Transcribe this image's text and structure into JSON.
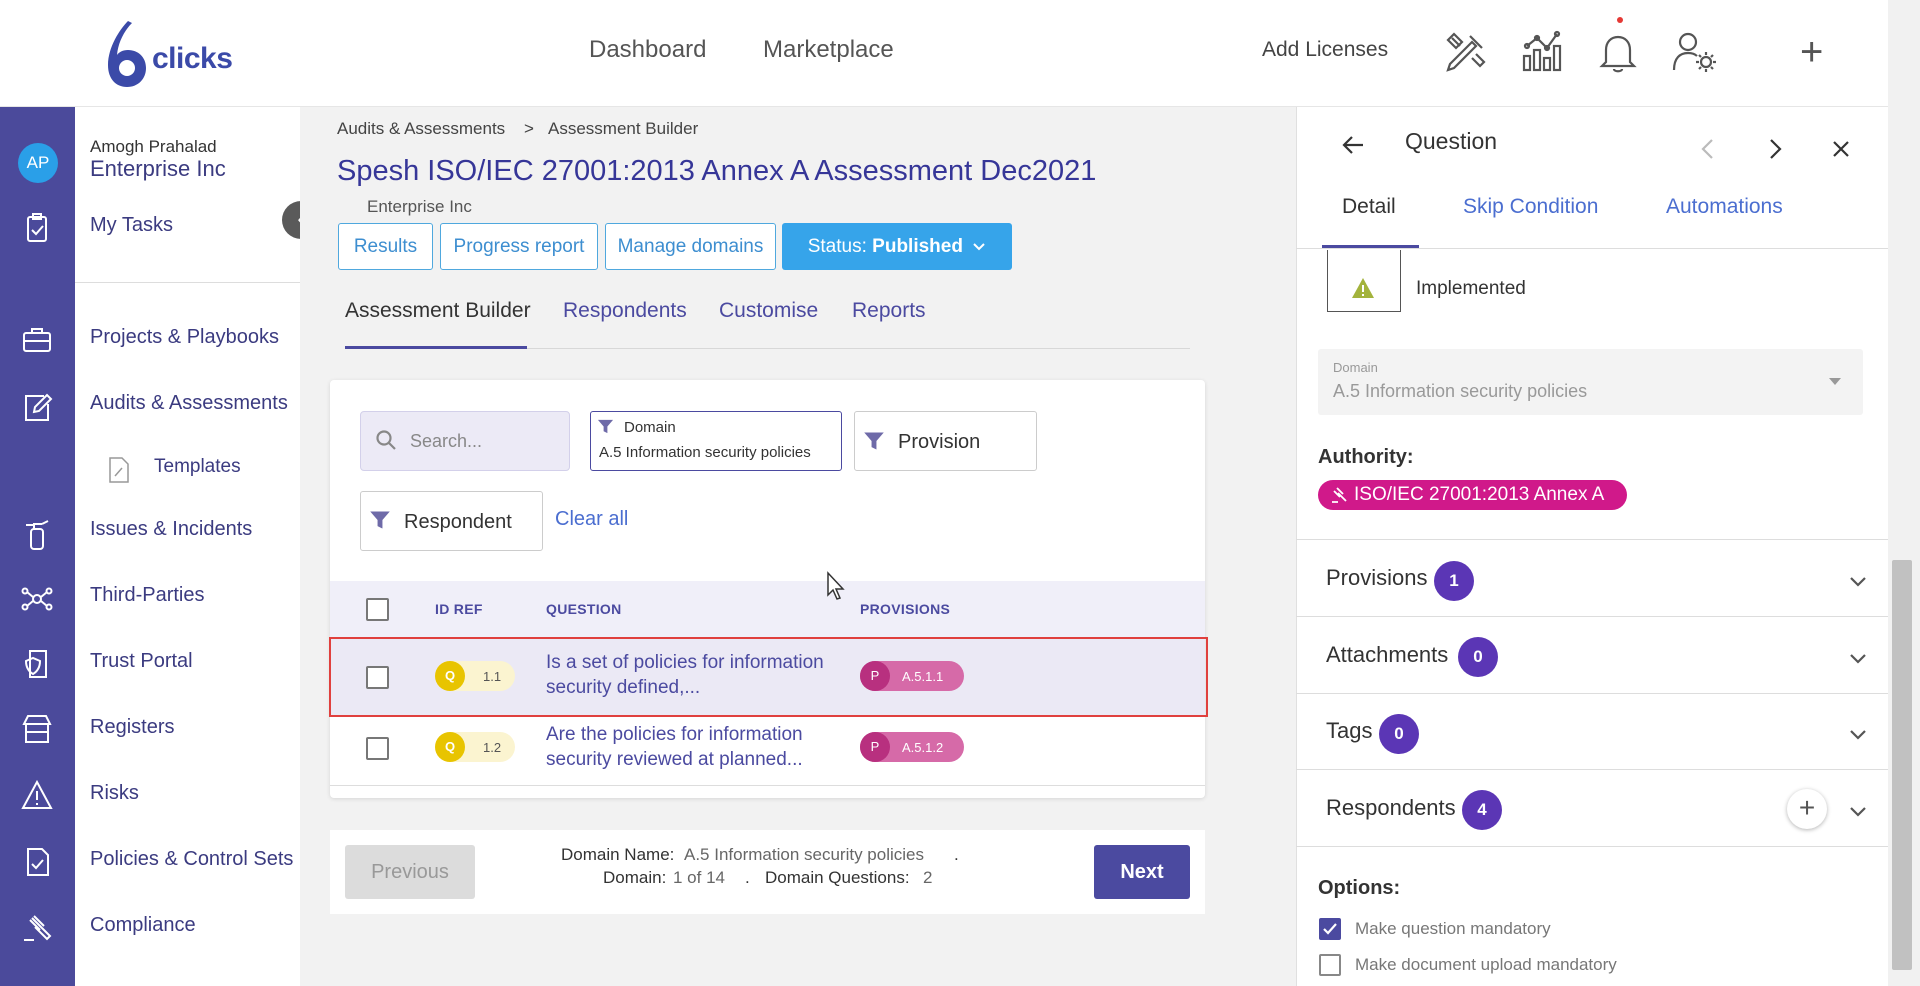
{
  "app": {
    "logo_text": "clicks",
    "colors": {
      "primary": "#4b4aa0",
      "accent": "#36a4ea",
      "authority": "#d0198a",
      "badge": "#5b36b5"
    }
  },
  "topnav": {
    "items": [
      {
        "label": "Dashboard"
      },
      {
        "label": "Marketplace"
      }
    ],
    "add_licenses": "Add Licenses",
    "icons": [
      "tools-icon",
      "analytics-icon",
      "bell-icon",
      "user-settings-icon",
      "plus-icon"
    ]
  },
  "user": {
    "initials": "AP",
    "name": "Amogh Prahalad",
    "org": "Enterprise Inc"
  },
  "sidebar": {
    "my_tasks": "My Tasks",
    "items": [
      {
        "label": "Projects & Playbooks",
        "icon": "briefcase-icon"
      },
      {
        "label": "Audits & Assessments",
        "icon": "edit-icon"
      },
      {
        "label": "Templates",
        "icon": "document-icon"
      },
      {
        "label": "Issues & Incidents",
        "icon": "fire-extinguisher-icon"
      },
      {
        "label": "Third-Parties",
        "icon": "network-icon"
      },
      {
        "label": "Trust Portal",
        "icon": "shield-doc-icon"
      },
      {
        "label": "Registers",
        "icon": "store-icon"
      },
      {
        "label": "Risks",
        "icon": "warning-icon"
      },
      {
        "label": "Policies & Control Sets",
        "icon": "policy-icon"
      },
      {
        "label": "Compliance",
        "icon": "gavel-icon"
      }
    ]
  },
  "breadcrumb": {
    "parent": "Audits & Assessments",
    "separator": ">",
    "current": "Assessment Builder"
  },
  "page": {
    "title": "Spesh ISO/IEC 27001:2013 Annex A Assessment Dec2021",
    "org": "Enterprise Inc",
    "buttons": {
      "results": "Results",
      "progress": "Progress report",
      "domains": "Manage domains"
    },
    "status_prefix": "Status:",
    "status_value": "Published",
    "tabs": [
      "Assessment Builder",
      "Respondents",
      "Customise",
      "Reports"
    ]
  },
  "filters": {
    "search_placeholder": "Search...",
    "domain_label": "Domain",
    "domain_value": "A.5 Information security policies",
    "provision_label": "Provision",
    "respondent_label": "Respondent",
    "clear_all": "Clear all"
  },
  "table": {
    "headers": {
      "id": "ID REF",
      "question": "QUESTION",
      "provisions": "PROVISIONS"
    },
    "rows": [
      {
        "type": "Q",
        "id": "1.1",
        "question": "Is a set of policies for information security defined,...",
        "prov_type": "P",
        "provision": "A.5.1.1",
        "selected": true
      },
      {
        "type": "Q",
        "id": "1.2",
        "question": "Are the policies for information security reviewed at planned...",
        "prov_type": "P",
        "provision": "A.5.1.2",
        "selected": false
      }
    ]
  },
  "pager": {
    "previous": "Previous",
    "next": "Next",
    "domain_name_label": "Domain Name:",
    "domain_name_value": "A.5 Information security policies",
    "domain_label": "Domain:",
    "domain_value": "1 of 14",
    "questions_label": "Domain Questions:",
    "questions_value": "2",
    "dot": "."
  },
  "panel": {
    "title": "Question",
    "tabs": [
      "Detail",
      "Skip Condition",
      "Automations"
    ],
    "implemented": "Implemented",
    "domain_caption": "Domain",
    "domain_value": "A.5 Information security policies",
    "authority_label": "Authority:",
    "authority_value": "ISO/IEC 27001:2013 Annex A",
    "sections": [
      {
        "title": "Provisions",
        "count": "1"
      },
      {
        "title": "Attachments",
        "count": "0"
      },
      {
        "title": "Tags",
        "count": "0"
      },
      {
        "title": "Respondents",
        "count": "4"
      }
    ],
    "options_label": "Options:",
    "options": [
      {
        "label": "Make question mandatory",
        "checked": true
      },
      {
        "label": "Make document upload mandatory",
        "checked": false
      }
    ]
  }
}
